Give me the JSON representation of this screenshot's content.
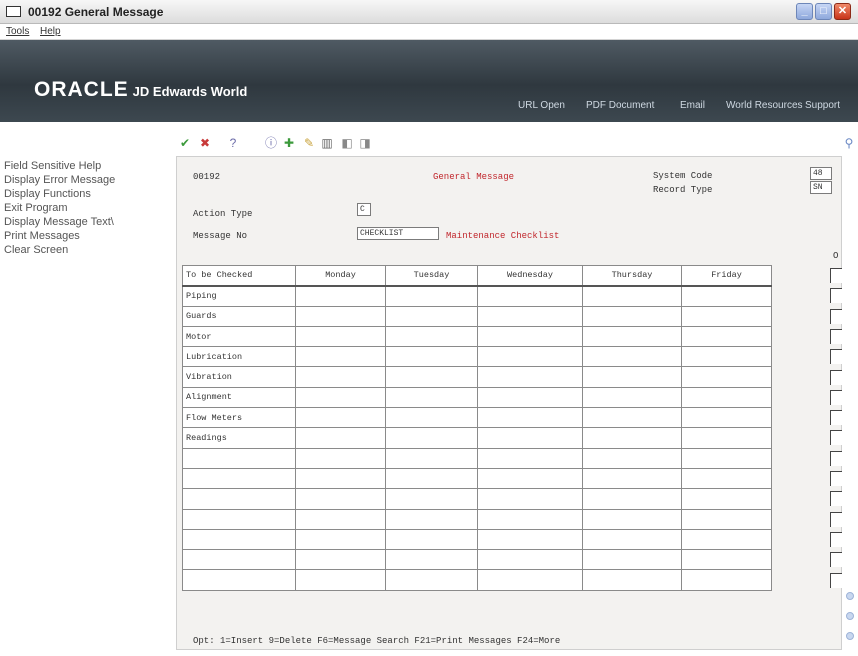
{
  "window": {
    "title": "00192   General Message"
  },
  "menu": {
    "items": [
      "Tools",
      "Help"
    ]
  },
  "banner": {
    "brand_oracle": "ORACLE",
    "brand_product": "JD Edwards World",
    "nav": [
      "URL Open",
      "PDF Document",
      "Email",
      "World Resources",
      "Support"
    ]
  },
  "left_menu": {
    "items": [
      "Field Sensitive Help",
      "Display Error Message",
      "Display Functions",
      "Exit Program",
      "Display Message Text\\",
      "Print Messages",
      "Clear Screen"
    ]
  },
  "toolbar": {
    "icons": [
      "check-icon",
      "cancel-icon",
      "help-icon",
      "info-icon",
      "add-icon",
      "change-icon",
      "delete-icon",
      "previous-icon",
      "next-icon",
      "search-icon"
    ],
    "help_glyph": "?"
  },
  "form": {
    "program_id": "00192",
    "screen_title": "General Message",
    "system_code_label": "System Code",
    "system_code_value": "48",
    "record_type_label": "Record Type",
    "record_type_value": "SN",
    "action_type_label": "Action Type",
    "action_type_value": "C",
    "message_no_label": "Message No",
    "message_no_value": "CHECKLIST",
    "message_desc": "Maintenance Checklist",
    "option_header": "O"
  },
  "grid": {
    "headers": [
      "To be Checked",
      "Monday",
      "Tuesday",
      "Wednesday",
      "Thursday",
      "Friday"
    ],
    "rows": [
      "Piping",
      "Guards",
      "Motor",
      " Lubrication",
      " Vibration",
      " Alignment",
      "Flow Meters",
      " Readings",
      "",
      "",
      "",
      "",
      "",
      "",
      ""
    ]
  },
  "footer": {
    "opt_text": "Opt:  1=Insert  9=Delete  F6=Message Search  F21=Print Messages  F24=More"
  },
  "colors": {
    "banner": "#3a444c",
    "form_bg": "#f3f2f0",
    "accent_red": "#c1272d"
  }
}
